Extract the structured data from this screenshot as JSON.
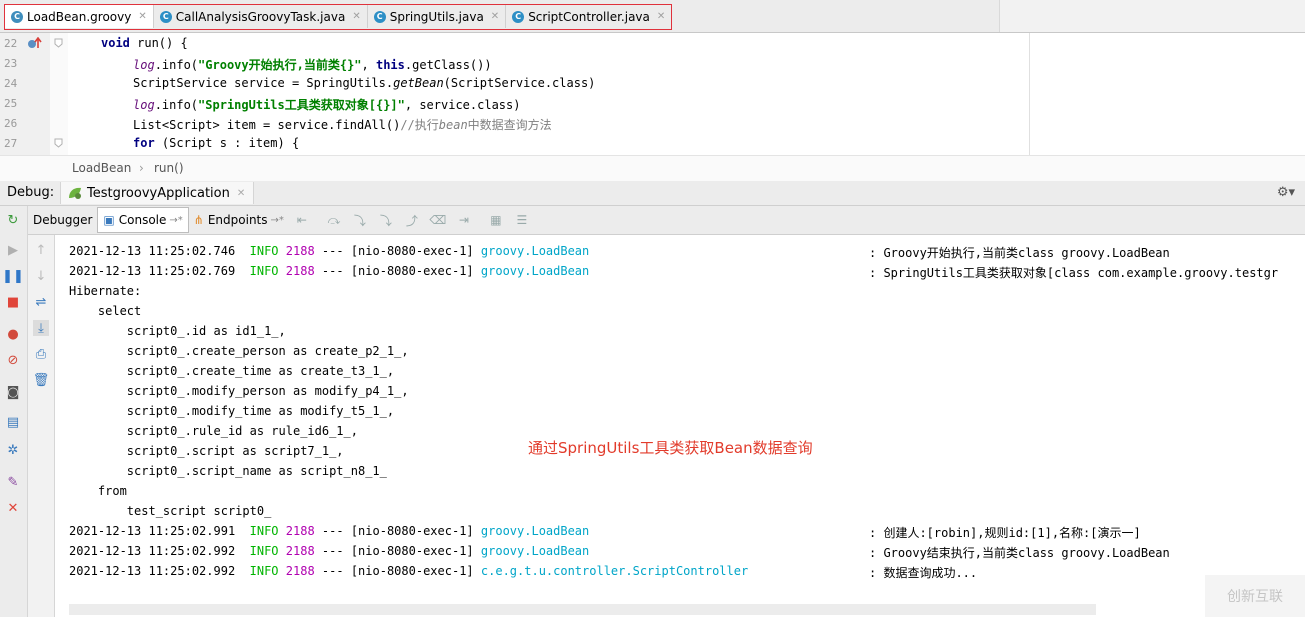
{
  "tabs": [
    {
      "label": "LoadBean.groovy",
      "icon": "groovy-class-icon",
      "active": true
    },
    {
      "label": "CallAnalysisGroovyTask.java",
      "icon": "java-class-icon",
      "active": false
    },
    {
      "label": "SpringUtils.java",
      "icon": "java-class-icon",
      "active": false
    },
    {
      "label": "ScriptController.java",
      "icon": "java-class-icon",
      "active": false
    }
  ],
  "editor": {
    "line_numbers": [
      "22",
      "23",
      "24",
      "25",
      "26",
      "27"
    ],
    "lines": {
      "l22": {
        "kw": "void",
        "rest": " run() {"
      },
      "l23": {
        "log": "log",
        "call": ".info(",
        "str": "\"Groovy开始执行,当前类{}\"",
        "sep": ", ",
        "kw": "this",
        "rest": ".getClass())"
      },
      "l24": {
        "pre": "ScriptService service = SpringUtils.",
        "it": "getBean",
        "rest": "(ScriptService.class)"
      },
      "l25": {
        "log": "log",
        "call": ".info(",
        "str": "\"SpringUtils工具类获取对象[{}]\"",
        "rest": ", service.class)"
      },
      "l26": {
        "pre": "List<Script> item = service.findAll()",
        "cmt1": "//执行",
        "cmt2": "bean",
        "cmt3": "中数据查询方法"
      },
      "l27": {
        "kw": "for",
        "rest": " (Script s : item) {"
      }
    }
  },
  "breadcrumb": {
    "items": [
      "LoadBean",
      "run()"
    ],
    "separator": "›"
  },
  "debug": {
    "label": "Debug:",
    "run_config": "TestgroovyApplication"
  },
  "toolbar": {
    "debugger": "Debugger",
    "console": "Console",
    "console_suffix": "→*",
    "endpoints": "Endpoints",
    "endpoints_suffix": "→*"
  },
  "console": {
    "log_lines": [
      {
        "ts": "2021-12-13 11:25:02.746",
        "level": "INFO",
        "pid": "2188",
        "sep": "---",
        "thread": "[nio-8080-exec-1]",
        "logger": "groovy.LoadBean",
        "msg": ": Groovy开始执行,当前类class groovy.LoadBean"
      },
      {
        "ts": "2021-12-13 11:25:02.769",
        "level": "INFO",
        "pid": "2188",
        "sep": "---",
        "thread": "[nio-8080-exec-1]",
        "logger": "groovy.LoadBean",
        "msg": ": SpringUtils工具类获取对象[class com.example.groovy.testgr"
      }
    ],
    "sql": [
      "Hibernate:",
      "    select",
      "        script0_.id as id1_1_,",
      "        script0_.create_person as create_p2_1_,",
      "        script0_.create_time as create_t3_1_,",
      "        script0_.modify_person as modify_p4_1_,",
      "        script0_.modify_time as modify_t5_1_,",
      "        script0_.rule_id as rule_id6_1_,",
      "        script0_.script as script7_1_,",
      "        script0_.script_name as script_n8_1_",
      "    from",
      "        test_script script0_"
    ],
    "log_lines_after": [
      {
        "ts": "2021-12-13 11:25:02.991",
        "level": "INFO",
        "pid": "2188",
        "sep": "---",
        "thread": "[nio-8080-exec-1]",
        "logger": "groovy.LoadBean",
        "msg": ": 创建人:[robin],规则id:[1],名称:[演示一]"
      },
      {
        "ts": "2021-12-13 11:25:02.992",
        "level": "INFO",
        "pid": "2188",
        "sep": "---",
        "thread": "[nio-8080-exec-1]",
        "logger": "groovy.LoadBean",
        "msg": ": Groovy结束执行,当前类class groovy.LoadBean"
      },
      {
        "ts": "2021-12-13 11:25:02.992",
        "level": "INFO",
        "pid": "2188",
        "sep": "---",
        "thread": "[nio-8080-exec-1]",
        "logger": "c.e.g.t.u.controller.ScriptController",
        "msg": ": 数据查询成功..."
      }
    ],
    "annotation": "通过SpringUtils工具类获取Bean数据查询"
  },
  "watermark": {
    "text": "创新互联"
  },
  "colors": {
    "highlight_border": "#e0323c",
    "info_level": "#00b400",
    "pid": "#b000b0",
    "logger": "#00a5c8",
    "annotation": "#e23b2b",
    "keyword": "#000080",
    "string": "#008000"
  }
}
